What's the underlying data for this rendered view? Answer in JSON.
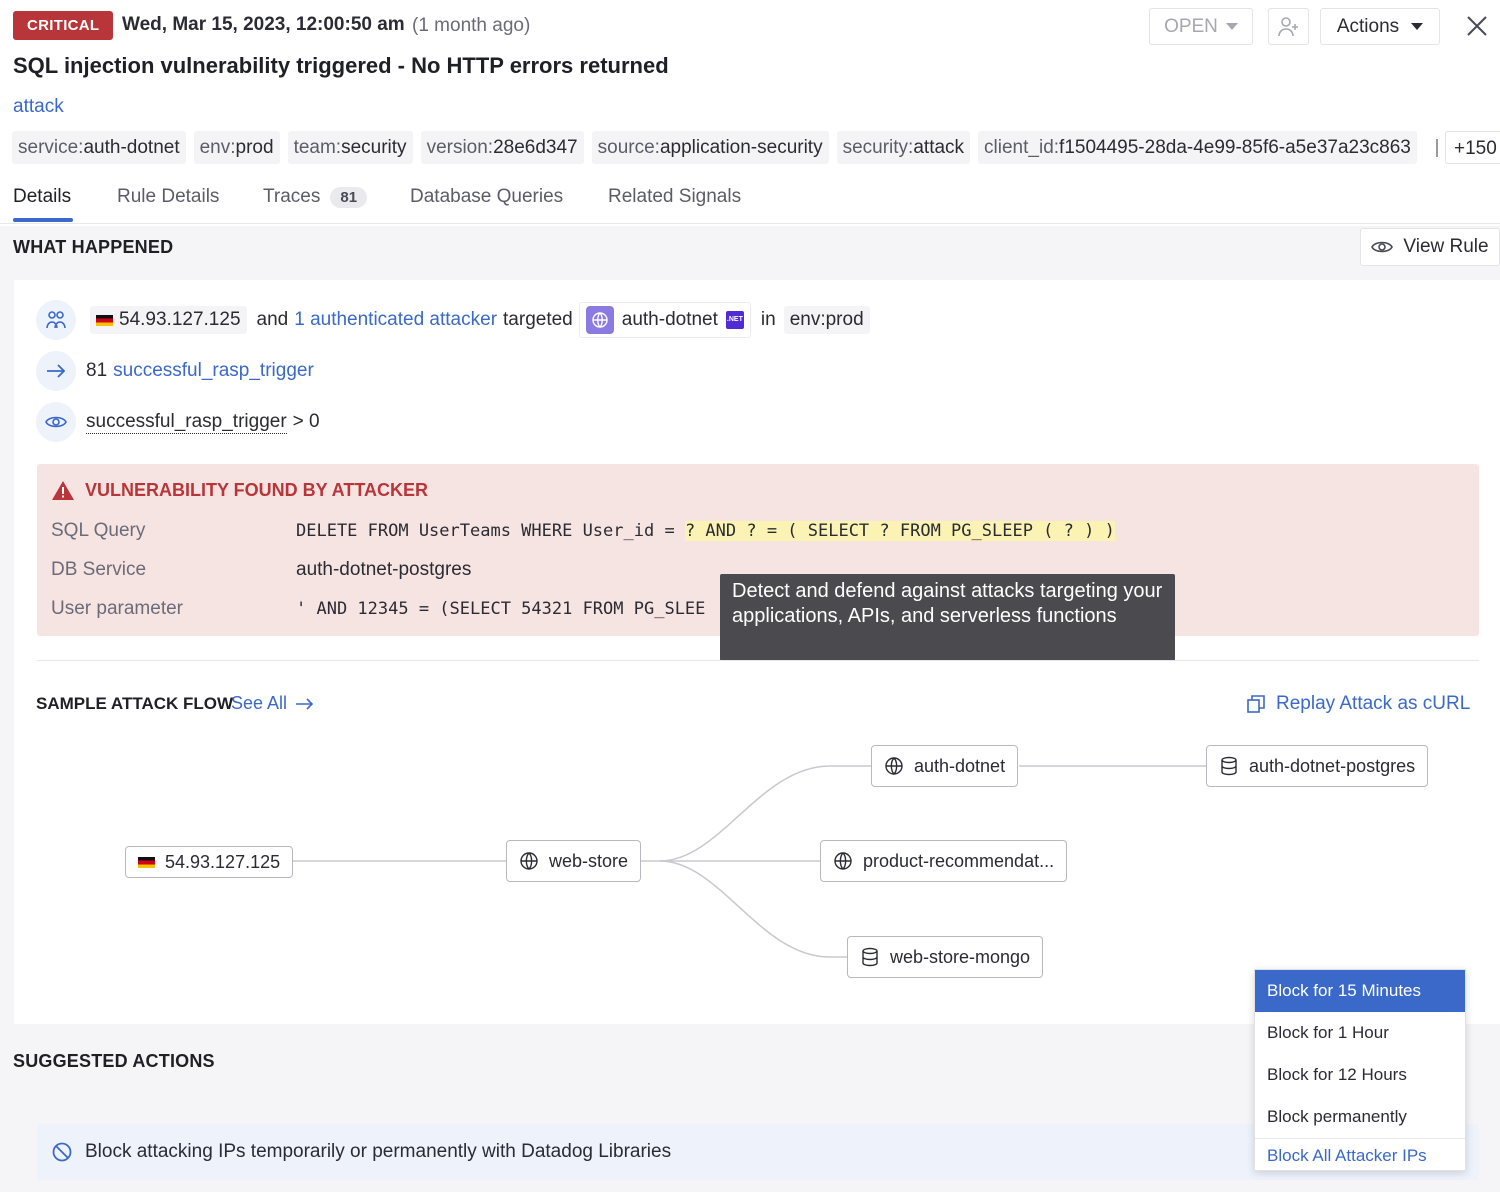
{
  "header": {
    "severity": "CRITICAL",
    "timestamp": "Wed, Mar 15, 2023, 12:00:50 am",
    "relative_time": "(1 month ago)",
    "status": "OPEN",
    "actions_label": "Actions",
    "title": "SQL injection vulnerability triggered - No HTTP errors returned",
    "category": "attack"
  },
  "tags": [
    {
      "key": "service:",
      "value": "auth-dotnet"
    },
    {
      "key": "env:",
      "value": "prod"
    },
    {
      "key": "team:",
      "value": "security"
    },
    {
      "key": "version:",
      "value": "28e6d347"
    },
    {
      "key": "source:",
      "value": "application-security"
    },
    {
      "key": "security:",
      "value": "attack"
    },
    {
      "key": "client_id:",
      "value": "f1504495-28da-4e99-85f6-a5e37a23c863"
    }
  ],
  "tags_more": "+150",
  "tabs": [
    {
      "label": "Details"
    },
    {
      "label": "Rule Details"
    },
    {
      "label": "Traces",
      "count": "81"
    },
    {
      "label": "Database Queries"
    },
    {
      "label": "Related Signals"
    }
  ],
  "what_happened": {
    "title": "WHAT HAPPENED",
    "view_rule": "View Rule",
    "row1": {
      "ip": "54.93.127.125",
      "and": "and",
      "attackers_link": "1 authenticated attacker",
      "targeted": "targeted",
      "service": "auth-dotnet",
      "dotnet_badge": ".NET",
      "in": "in",
      "env": "env:prod"
    },
    "row2": {
      "count": "81",
      "metric": "successful_rasp_trigger"
    },
    "row3": {
      "metric": "successful_rasp_trigger",
      "condition": "> 0"
    }
  },
  "vulnerability": {
    "title": "VULNERABILITY FOUND BY ATTACKER",
    "sql_label": "SQL Query",
    "sql_plain": "DELETE FROM UserTeams WHERE User_id = ",
    "sql_highlight": "? AND ? = ( SELECT ? FROM PG_SLEEP ( ? ) )",
    "db_label": "DB Service",
    "db_value": "auth-dotnet-postgres",
    "param_label": "User parameter",
    "param_value": "' AND 12345 = (SELECT 54321 FROM PG_SLEE"
  },
  "tooltip": "Detect and defend against attacks targeting your applications, APIs, and serverless functions",
  "attack_flow": {
    "title": "SAMPLE ATTACK FLOW",
    "see_all": "See All",
    "replay": "Replay Attack as cURL",
    "nodes": {
      "source": "54.93.127.125",
      "web_store": "web-store",
      "auth_dotnet": "auth-dotnet",
      "product_rec": "product-recommendat...",
      "web_store_mongo": "web-store-mongo",
      "auth_db": "auth-dotnet-postgres"
    }
  },
  "suggested": {
    "title": "SUGGESTED ACTIONS",
    "block_text": "Block attacking IPs temporarily or permanently with Datadog Libraries"
  },
  "block_menu": {
    "items": [
      "Block for 15 Minutes",
      "Block for 1 Hour",
      "Block for 12 Hours",
      "Block permanently"
    ],
    "all_label": "Block All Attacker IPs"
  },
  "colors": {
    "critical": "#b8363a",
    "link": "#3a69c9",
    "vuln_bg": "#f6e4e3",
    "highlight": "#fbf3b4"
  }
}
